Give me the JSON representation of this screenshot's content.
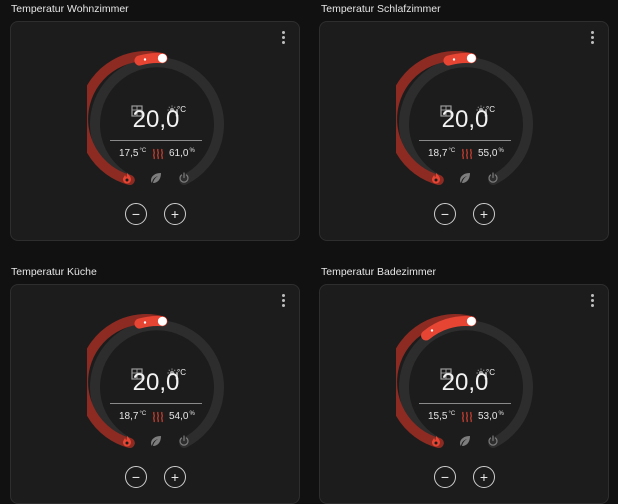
{
  "thermostats": [
    {
      "title": "Temperatur Wohnzimmer",
      "target": "20,0",
      "unit": "°C",
      "current": "17,5",
      "current_unit": "°C",
      "humidity": "61,0",
      "humidity_unit": "%",
      "minus": "−",
      "plus": "+"
    },
    {
      "title": "Temperatur Schlafzimmer",
      "target": "20,0",
      "unit": "°C",
      "current": "18,7",
      "current_unit": "°C",
      "humidity": "55,0",
      "humidity_unit": "%",
      "minus": "−",
      "plus": "+"
    },
    {
      "title": "Temperatur Küche",
      "target": "20,0",
      "unit": "°C",
      "current": "18,7",
      "current_unit": "°C",
      "humidity": "54,0",
      "humidity_unit": "%",
      "minus": "−",
      "plus": "+"
    },
    {
      "title": "Temperatur Badezimmer",
      "target": "20,0",
      "unit": "°C",
      "current": "15,5",
      "current_unit": "°C",
      "humidity": "53,0",
      "humidity_unit": "%",
      "minus": "−",
      "plus": "+"
    }
  ],
  "icons": {
    "menu": "more-vertical-icon",
    "window": "window-icon",
    "mode": "sun-thermometer-icon",
    "heat": "heat-waves-icon",
    "flame": "flame-icon",
    "eco": "leaf-icon",
    "power": "power-icon"
  },
  "colors": {
    "background": "#111111",
    "card": "#1c1c1c",
    "heat_active": "#e64534",
    "heat_fill": "#8d2b22",
    "track": "#2d2d2d"
  }
}
